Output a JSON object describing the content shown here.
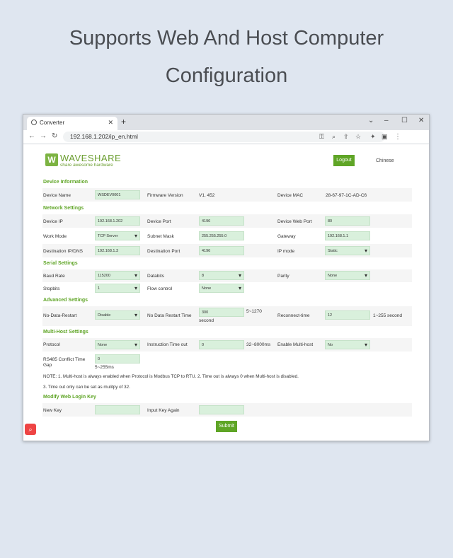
{
  "headline": {
    "line1": "Supports Web And Host Computer",
    "line2": "Configuration"
  },
  "browser": {
    "tab_title": "Converter",
    "url": "192.168.1.202/ip_en.html"
  },
  "header": {
    "logo_name": "WAVESHARE",
    "logo_tagline": "share awesome hardware",
    "logout_label": "Logout",
    "language_label": "Chinese"
  },
  "device_info": {
    "title": "Device Information",
    "device_name_label": "Device Name",
    "device_name": "WSDEV0001",
    "firmware_label": "Firmware Version",
    "firmware": "V1. 452",
    "mac_label": "Device MAC",
    "mac": "28-67-97-1C-AD-C6"
  },
  "network": {
    "title": "Network Settings",
    "ip_label": "Device IP",
    "ip": "192.168.1.202",
    "port_label": "Device Port",
    "port": "4196",
    "webport_label": "Device Web Port",
    "webport": "80",
    "workmode_label": "Work Mode",
    "workmode": "TCP Server",
    "subnet_label": "Subnet Mask",
    "subnet": "255.255.255.0",
    "gateway_label": "Gateway",
    "gateway": "192.168.1.1",
    "destip_label": "Destination IP/DNS",
    "destip": "192.168.1.3",
    "destport_label": "Destination Port",
    "destport": "4196",
    "ipmode_label": "IP mode",
    "ipmode": "Static"
  },
  "serial": {
    "title": "Serial Settings",
    "baud_label": "Baud Rate",
    "baud": "115200",
    "databits_label": "Databits",
    "databits": "8",
    "parity_label": "Parity",
    "parity": "None",
    "stopbits_label": "Stopbits",
    "stopbits": "1",
    "flow_label": "Flow control",
    "flow": "None"
  },
  "advanced": {
    "title": "Advanced Settings",
    "nodata_label": "No-Data-Restart",
    "nodata": "Disable",
    "nodatatime_label": "No Data Restart Time",
    "nodatatime": "300",
    "nodatatime_range": "5~1270",
    "nodatatime_unit": "second",
    "reconnect_label": "Reconnect-time",
    "reconnect": "12",
    "reconnect_range": "1~255 second"
  },
  "multihost": {
    "title": "Multi-Host Settings",
    "protocol_label": "Protocol",
    "protocol": "None",
    "timeout_label": "Instruction Time out",
    "timeout": "0",
    "timeout_range": "32~8000ms",
    "enable_label": "Enable Multi-host",
    "enable": "No",
    "conflict_label_1": "RS485 Conflict Time",
    "conflict_label_2": "Gap",
    "conflict": "0",
    "conflict_range": "5~255ms",
    "note1": "NOTE: 1. Multi-host is always enabled when Protocol is Modbus TCP to RTU. 2. Time out is always 0 when Multi-host is disabled.",
    "note2": "3. Time out only can be set as mulitpy of 32."
  },
  "login": {
    "title": "Modify Web Login Key",
    "newkey_label": "New Key",
    "again_label": "Input Key Again",
    "submit_label": "Submit"
  }
}
